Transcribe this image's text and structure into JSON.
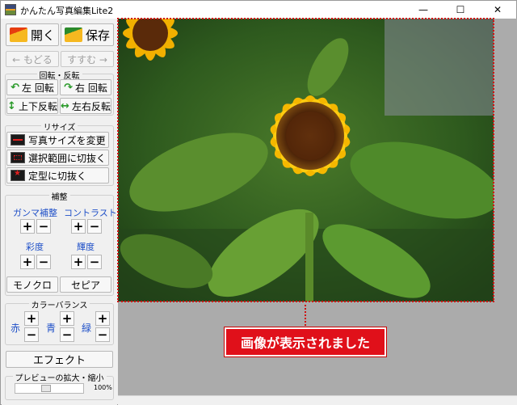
{
  "window": {
    "title": "かんたん写真編集Lite2",
    "min": "—",
    "max": "☐",
    "close": "✕"
  },
  "toolbar": {
    "open_label": "開く",
    "save_label": "保存",
    "back_label": "← もどる",
    "forward_label": "すすむ →"
  },
  "rotate": {
    "title": "回転・反転",
    "left_rotate": "左 回転",
    "right_rotate": "右 回転",
    "flip_vertical": "上下反転",
    "flip_horizontal": "左右反転"
  },
  "resize": {
    "title": "リサイズ",
    "change_size": "写真サイズを変更",
    "crop_selection": "選択範囲に切抜く",
    "crop_fixed": "定型に切抜く"
  },
  "adjust": {
    "title": "補整",
    "gamma": "ガンマ補整",
    "contrast": "コントラスト",
    "saturation": "彩度",
    "brightness": "輝度",
    "plus": "+",
    "minus": "−",
    "mono": "モノクロ",
    "sepia": "セピア"
  },
  "color_balance": {
    "title": "カラーバランス",
    "red": "赤",
    "green": "青",
    "blue": "緑"
  },
  "effect_label": "エフェクト",
  "zoom": {
    "title": "プレビューの拡大・縮小",
    "value": "100%",
    "level": 0.45
  },
  "callout_text": "画像が表示されました",
  "colors": {
    "accent_red": "#e0101a",
    "label_blue": "#1f50c8"
  }
}
